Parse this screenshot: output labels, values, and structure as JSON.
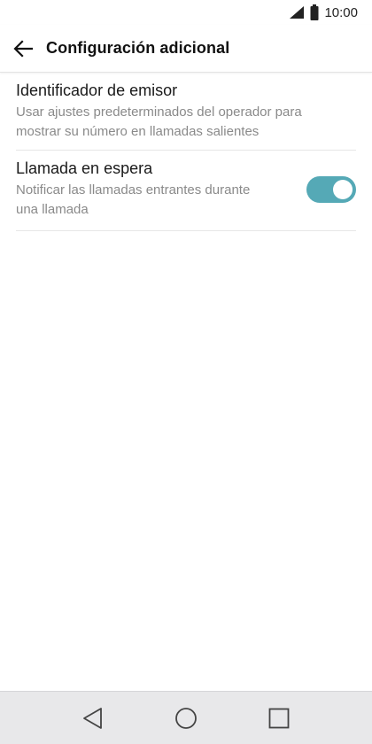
{
  "status_bar": {
    "time": "10:00",
    "icons": [
      "signal-icon",
      "battery-icon"
    ]
  },
  "toolbar": {
    "title": "Configuración adicional",
    "back_icon": "arrow-left-icon"
  },
  "settings": [
    {
      "title": "Identificador de emisor",
      "summary_line1": "Usar ajustes predeterminados del operador para",
      "summary_line2": "mostrar su número en llamadas salientes"
    },
    {
      "title": "Llamada en espera",
      "summary_line1": "Notificar las llamadas entrantes durante",
      "summary_line2": "una llamada",
      "toggle_on": true
    }
  ],
  "colors": {
    "accent": "#55a9b6",
    "nav_bar": "#e8e8ea"
  },
  "nav_bar": {
    "buttons": [
      "back-triangle-icon",
      "home-circle-icon",
      "recents-square-icon"
    ]
  }
}
